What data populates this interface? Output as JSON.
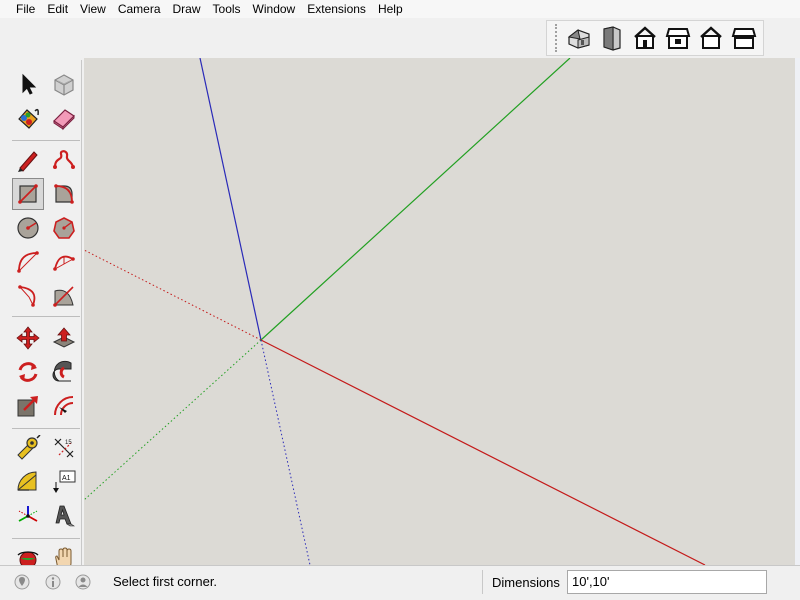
{
  "menubar": {
    "items": [
      "File",
      "Edit",
      "View",
      "Camera",
      "Draw",
      "Tools",
      "Window",
      "Extensions",
      "Help"
    ]
  },
  "views_toolbar": {
    "buttons": [
      "iso-view-icon",
      "top-view-icon",
      "front-view-icon",
      "right-view-icon",
      "back-view-icon",
      "left-view-icon"
    ]
  },
  "tools": {
    "items": [
      "select-arrow-icon",
      "component-icon",
      "paint-bucket-icon",
      "eraser-icon",
      "pencil-icon",
      "freehand-icon",
      "rectangle-icon",
      "rotated-rectangle-icon",
      "circle-icon",
      "polygon-icon",
      "arc-icon",
      "two-point-arc-icon",
      "three-point-arc-icon",
      "pie-icon",
      "move-icon",
      "push-pull-icon",
      "rotate-icon",
      "follow-me-icon",
      "scale-icon",
      "offset-icon",
      "tape-measure-icon",
      "dimension-icon",
      "protractor-icon",
      "text-icon",
      "axes-icon",
      "3d-text-icon",
      "orbit-icon",
      "pan-icon"
    ],
    "active": "rectangle-icon",
    "text_tool_label": "A1"
  },
  "colors": {
    "viewport_bg": "#dcdad5",
    "axis_red": "#cc0000",
    "axis_green": "#00aa00",
    "axis_blue": "#0000cc",
    "tool_red": "#cc1f1f"
  },
  "status": {
    "message": "Select first corner.",
    "dimensions_label": "Dimensions",
    "dimensions_value": "10',10'",
    "icons": [
      "geolocation-icon",
      "credits-icon",
      "account-icon"
    ]
  }
}
